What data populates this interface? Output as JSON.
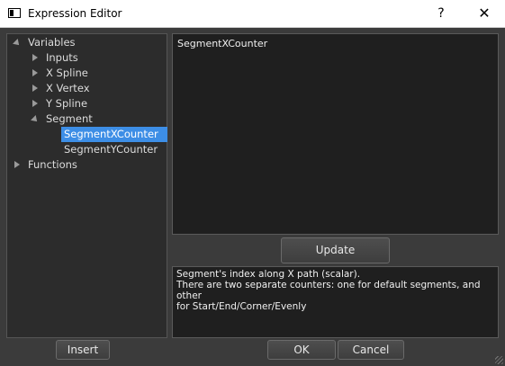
{
  "window": {
    "title": "Expression Editor",
    "help_glyph": "?",
    "close_glyph": "✕"
  },
  "tree": {
    "variables_label": "Variables",
    "inputs_label": "Inputs",
    "x_spline_label": "X Spline",
    "x_vertex_label": "X Vertex",
    "y_spline_label": "Y Spline",
    "segment_label": "Segment",
    "segment_x_counter_label": "SegmentXCounter",
    "segment_y_counter_label": "SegmentYCounter",
    "functions_label": "Functions",
    "selected_item": "SegmentXCounter"
  },
  "editor": {
    "expression_text": "SegmentXCounter"
  },
  "buttons": {
    "update_label": "Update",
    "insert_label": "Insert",
    "ok_label": "OK",
    "cancel_label": "Cancel"
  },
  "description": {
    "line1": "Segment's index along X path (scalar).",
    "line2": "There are two separate counters: one for default segments, and other",
    "line3": "for Start/End/Corner/Evenly"
  },
  "colors": {
    "selection": "#3d8ee6",
    "panel_background": "#3b3b3b",
    "editor_background": "#1f1f1f"
  }
}
